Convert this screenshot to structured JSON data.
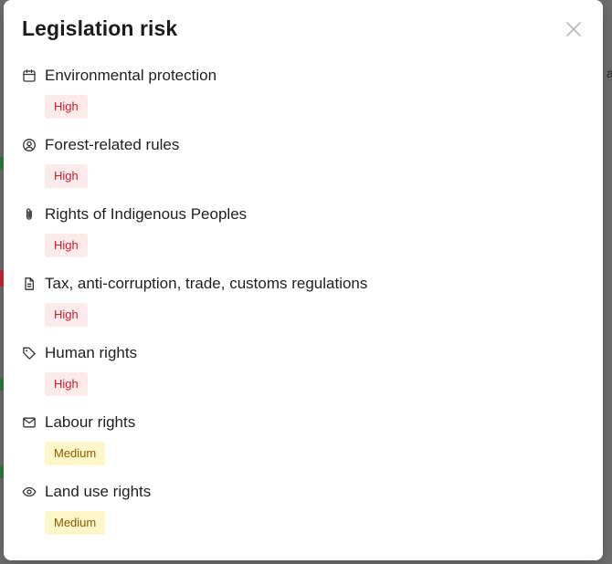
{
  "modal": {
    "title": "Legislation risk",
    "close_icon": "close-icon"
  },
  "risks": [
    {
      "label": "Environmental protection",
      "icon": "calendar-icon",
      "level": "High",
      "severity": "high"
    },
    {
      "label": "Forest-related rules",
      "icon": "user-circle-icon",
      "level": "High",
      "severity": "high"
    },
    {
      "label": "Rights of Indigenous Peoples",
      "icon": "paperclip-icon",
      "level": "High",
      "severity": "high"
    },
    {
      "label": "Tax, anti-corruption, trade, customs regulations",
      "icon": "document-icon",
      "level": "High",
      "severity": "high"
    },
    {
      "label": "Human rights",
      "icon": "tag-icon",
      "level": "High",
      "severity": "high"
    },
    {
      "label": "Labour rights",
      "icon": "mail-icon",
      "level": "Medium",
      "severity": "medium"
    },
    {
      "label": "Land use rights",
      "icon": "eye-icon",
      "level": "Medium",
      "severity": "medium"
    }
  ],
  "colors": {
    "high_text": "#c8202f",
    "high_bg": "#fdeaea",
    "medium_text": "#8a5b00",
    "medium_bg": "#fdf6c8"
  }
}
